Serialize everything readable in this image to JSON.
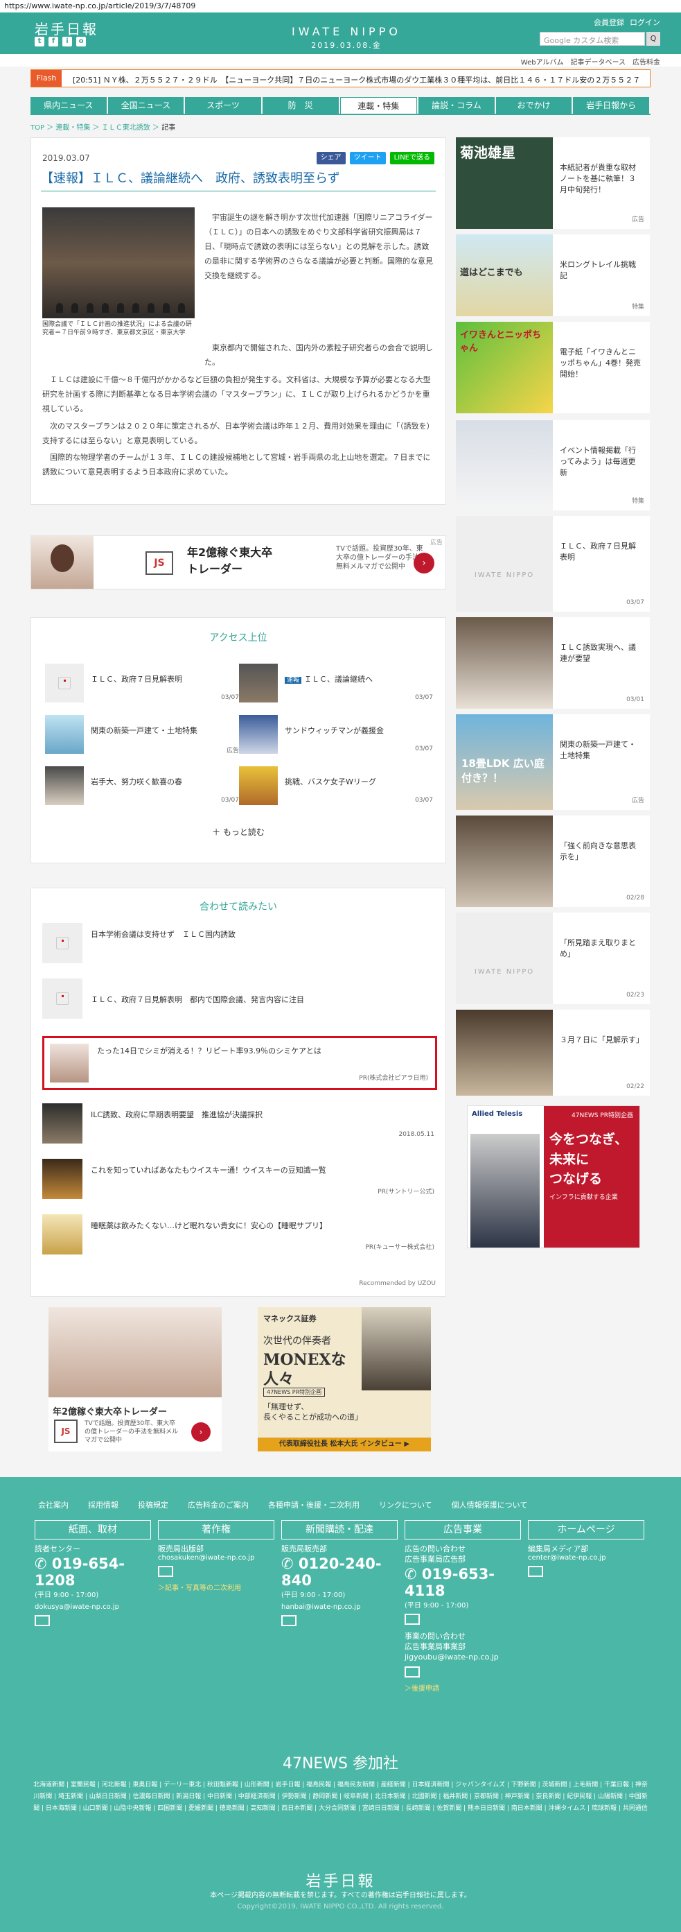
{
  "url": "https://www.iwate-np.co.jp/article/2019/3/7/48709",
  "header": {
    "logo": "岩手日報",
    "brand": "IWATE NIPPO",
    "date": "2019.03.08.金",
    "register": "会員登録",
    "login": "ログイン",
    "search_placeholder": "Google カスタム検索",
    "search_btn": "Q",
    "social": [
      "t",
      "f",
      "i",
      "o"
    ]
  },
  "subnav": [
    "Webアルバム",
    "記事データベース",
    "広告料金"
  ],
  "flash": {
    "tag": "Flash",
    "text": "[20:51] ＮＹ株、２万５５２７・２９ドル　【ニューヨーク共同】７日のニューヨーク株式市場のダウ工業株３０種平均は、前日比１４６・１７ドル安の２万５５２７..."
  },
  "nav": [
    "県内ニュース",
    "全国ニュース",
    "スポーツ",
    "防　災",
    "連載・特集",
    "論説・コラム",
    "おでかけ",
    "岩手日報から"
  ],
  "breadcrumb": {
    "top": "TOP",
    "a": "連載・特集",
    "b": "ＩＬＣ東北誘致",
    "c": "記事"
  },
  "article": {
    "date": "2019.03.07",
    "share": "シェア",
    "tweet": "ツイート",
    "line": "LINEで送る",
    "title": "【速報】ＩＬＣ、議論継続へ　政府、誘致表明至らず",
    "caption": "国際会議で「ＩＬＣ計画の推進状況」による会議の研究者＝７日午前９時すぎ、東京都文京区・東京大学",
    "lead": "　宇宙誕生の謎を解き明かす次世代加速器「国際リニアコライダー（ＩＬＣ）」の日本への誘致をめぐり文部科学省研究振興局は７日、「現時点で誘致の表明には至らない」との見解を示した。誘致の是非に関する学術界のさらなる議論が必要と判断。国際的な意見交換を継続する。",
    "p1": "　東京都内で開催された、国内外の素粒子研究者らの会合で説明した。",
    "p2": "　ＩＬＣは建設に千億〜８千億円がかかるなど巨額の負担が発生する。文科省は、大規模な予算が必要となる大型研究を計画する際に判断基準となる日本学術会議の「マスタープラン」に、ＩＬＣが取り上げられるかどうかを重視している。",
    "p3": "　次のマスタープランは２０２０年に策定されるが、日本学術会議は昨年１２月、費用対効果を理由に「（誘致を）支持するには至らない」と意見表明している。",
    "p4": "　国際的な物理学者のチームが１３年、ＩＬＣの建設候補地として宮城・岩手両県の北上山地を選定。７日までに誘致について意見表明するよう日本政府に求めていた。"
  },
  "ad1": {
    "logo": "JS",
    "headline": "年2億稼ぐ東大卒\nトレーダー",
    "sub": "TVで話題。投資歴30年、東大卒の億トレーダーの手法を無料メルマガで公開中",
    "label": "広告"
  },
  "ranking": {
    "title": "アクセス上位",
    "more": "＋ もっと読む",
    "items": [
      {
        "title": "ＩＬＣ、政府７日見解表明",
        "date": "03/07"
      },
      {
        "badge": "速報",
        "title": "ＩＬＣ、議論継続へ",
        "date": "03/07"
      },
      {
        "title": "関東の新築一戸建て・土地特集",
        "date": "広告"
      },
      {
        "title": "サンドウィッチマンが義援金",
        "date": "03/07"
      },
      {
        "title": "岩手大、努力咲く歓喜の春",
        "date": "03/07"
      },
      {
        "title": "挑戦、バスケ女子Wリーグ",
        "date": "03/07"
      }
    ]
  },
  "related": {
    "title": "合わせて読みたい",
    "recommended": "Recommended by UZOU",
    "items": [
      {
        "title": "日本学術会議は支持せず　ＩＬＣ国内誘致",
        "date": ""
      },
      {
        "title": "ＩＬＣ、政府７日見解表明　都内で国際会議、発言内容に注目",
        "date": ""
      },
      {
        "title": "たった14日でシミが消える！？リピート率93.9％のシミケアとは",
        "date": "PR(株式会社ピアラ日用)"
      },
      {
        "title": "ILC誘致、政府に早期表明要望　推進協が決議採択",
        "date": "2018.05.11"
      },
      {
        "title": "これを知っていればあなたもウイスキー通！ウイスキーの豆知識一覧",
        "date": "PR(サントリー公式)"
      },
      {
        "title": "睡眠薬は飲みたくない…けど眠れない貴女に！安心の【睡眠サプリ】",
        "date": "PR(キューサー株式会社)"
      }
    ]
  },
  "bottom_ads": {
    "a": {
      "headline": "年2億稼ぐ東大卒トレーダー",
      "sub": "TVで話題。投資歴30年、東大卒の億トレーダーの手法を無料メルマガで公開中"
    },
    "b": {
      "brand": "マネックス証券",
      "l1": "次世代の伴奏者",
      "l2": "MONEXな",
      "l3": "人々",
      "l4": "47NEWS PR特別企画",
      "quote": "「無理せず、\n長くやることが成功への道」",
      "bar": "代表取締役社長 松本大氏 インタビュー ▶"
    }
  },
  "sidebar": [
    {
      "title": "本紙記者が貴重な取材ノートを基に執筆！３月中旬発行！",
      "tag": "広告",
      "imgtext": "菊池雄星"
    },
    {
      "title": "米ロングトレイル挑戦記",
      "tag": "特集",
      "imgtext": "道はどこまでも"
    },
    {
      "title": "電子紙「イワきんとニッポちゃん」4巻！発売開始！",
      "tag": "",
      "imgtext": "イワきんとニッポちゃん"
    },
    {
      "title": "イベント情報掲載「行ってみよう」は毎週更新",
      "tag": "特集",
      "imgtext": ""
    },
    {
      "title": "ＩＬＣ、政府７日見解表明",
      "tag": "03/07",
      "imgtext": "IWATE NIPPO"
    },
    {
      "title": "ＩＬＣ誘致実現へ、議連が要望",
      "tag": "03/01",
      "imgtext": ""
    },
    {
      "title": "関東の新築一戸建て・土地特集",
      "tag": "広告",
      "imgtext": "18畳LDK 広い庭付き？！"
    },
    {
      "title": "「強く前向きな意思表示を」",
      "tag": "02/28",
      "imgtext": ""
    },
    {
      "title": "「所見踏まえ取りまとめ」",
      "tag": "02/23",
      "imgtext": "IWATE NIPPO"
    },
    {
      "title": "３月７日に「見解示す」",
      "tag": "02/22",
      "imgtext": ""
    }
  ],
  "sidead": {
    "corp": "Allied Telesis",
    "top": "47NEWS PR特別企画",
    "l1": "今をつなぎ、",
    "l2": "未来に",
    "l3": "つなげる",
    "sub": "インフラに貢献する企業"
  },
  "footer": {
    "links": [
      "会社案内",
      "採用情報",
      "投稿規定",
      "広告料金のご案内",
      "各種申請・後援・二次利用",
      "リンクについて",
      "個人情報保護について"
    ],
    "cols": [
      {
        "h": "紙面、取材",
        "l1": "読者センター",
        "phone": "019-654-1208",
        "hours": "(平日 9:00 - 17:00)",
        "mail": "dokusya@iwate-np.co.jp",
        "l2": "",
        "link": ""
      },
      {
        "h": "著作権",
        "l1": "販売局出版部",
        "phone": "",
        "hours": "",
        "mail": "chosakuken@iwate-np.co.jp",
        "l2": "",
        "link": "＞記事・写真等の二次利用"
      },
      {
        "h": "新聞購読・配達",
        "l1": "販売局販売部",
        "phone": "0120-240-840",
        "hours": "(平日 9:00 - 17:00)",
        "mail": "hanbai@iwate-np.co.jp",
        "l2": "",
        "link": ""
      },
      {
        "h": "広告事業",
        "l1": "広告の問い合わせ\n広告事業局広告部",
        "phone": "019-653-4118",
        "hours": "(平日 9:00 - 17:00)",
        "mail": "",
        "l2": "事業の問い合わせ\n広告事業局事業部\njigyoubu@iwate-np.co.jp",
        "link": "＞後援申請"
      },
      {
        "h": "ホームページ",
        "l1": "編集局メディア部",
        "phone": "",
        "hours": "",
        "mail": "center@iwate-np.co.jp",
        "l2": "",
        "link": ""
      }
    ],
    "np_title": "47NEWS 参加社",
    "np_list": "北海道新聞 | 室蘭民報 | 河北新報 | 東奥日報 | デーリー東北 | 秋田魁新報 | 山形新聞 | 岩手日報 | 福島民報 | 福島民友新聞 | 産経新聞 | 日本経済新聞 | ジャパンタイムズ | 下野新聞 | 茨城新聞 | 上毛新聞 | 千葉日報 | 神奈川新聞 | 埼玉新聞 | 山梨日日新聞 | 信濃毎日新聞 | 新潟日報 | 中日新聞 | 中部経済新聞 | 伊勢新聞 | 静岡新聞 | 岐阜新聞 | 北日本新聞 | 北國新聞 | 福井新聞 | 京都新聞 | 神戸新聞 | 奈良新聞 | 紀伊民報 | 山陽新聞 | 中国新聞 | 日本海新聞 | 山口新聞 | 山陰中央新報 | 四国新聞 | 愛媛新聞 | 徳島新聞 | 高知新聞 | 西日本新聞 | 大分合同新聞 | 宮崎日日新聞 | 長崎新聞 | 佐賀新聞 | 熊本日日新聞 | 南日本新聞 | 沖縄タイムス | 琉球新報 | 共同通信",
    "logo": "岩手日報",
    "notice": "本ページ掲載内容の無断転載を禁じます。すべての著作権は岩手日報社に属します。",
    "copy": "Copyright©2019, IWATE NIPPO CO.,LTD. All rights reserved."
  },
  "colors": {
    "brand": "#36a899",
    "footer": "#4bb7a6",
    "title": "#1a6aa8",
    "flash": "#e95b2b",
    "highlight": "#d50f1e"
  }
}
